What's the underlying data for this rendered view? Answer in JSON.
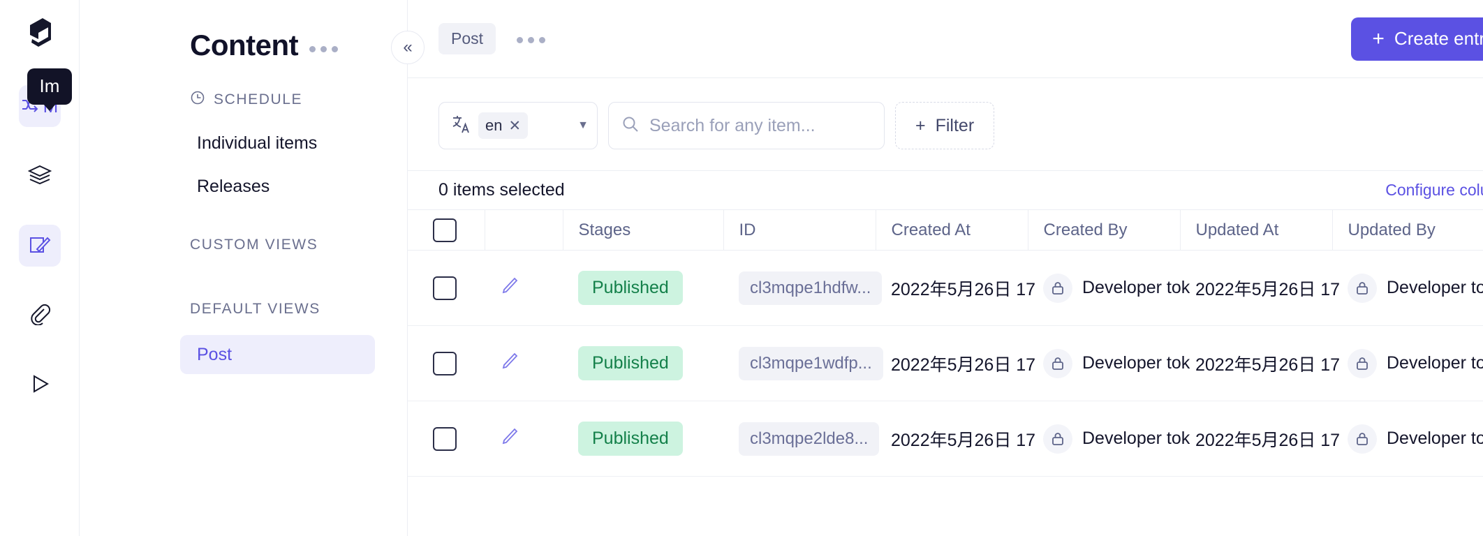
{
  "rail": {
    "logo_icon": "graphcms-logo-icon",
    "tooltip_text": "Im",
    "items": [
      {
        "icon": "schedule-shuffle-icon",
        "label": "M",
        "active": true
      },
      {
        "icon": "layers-icon",
        "label": "",
        "active": false
      },
      {
        "icon": "content-edit-icon",
        "label": "",
        "active": true
      },
      {
        "icon": "paperclip-icon",
        "label": "",
        "active": false
      },
      {
        "icon": "play-icon",
        "label": "",
        "active": false
      }
    ]
  },
  "sidebar": {
    "title": "Content",
    "more_icon": "ellipsis-icon",
    "schedule_label": "SCHEDULE",
    "schedule_icon": "clock-icon",
    "schedule_items": [
      "Individual items",
      "Releases"
    ],
    "custom_views_label": "CUSTOM VIEWS",
    "default_views_label": "DEFAULT VIEWS",
    "default_views_items": [
      {
        "label": "Post",
        "active": true
      }
    ]
  },
  "topbar": {
    "model_tag": "Post",
    "more_icon": "ellipsis-icon",
    "create_label": "Create entry",
    "create_plus": "+",
    "accent_color": "#5b51e3"
  },
  "toolbar": {
    "collapse_icon": "chevron-double-left-icon",
    "translate_icon": "translate-icon",
    "locale_value": "en",
    "locale_remove_icon": "close-icon",
    "locale_caret_icon": "chevron-down-icon",
    "search_icon": "search-icon",
    "search_value": "",
    "search_placeholder": "Search for any item...",
    "filter_plus": "+",
    "filter_label": "Filter"
  },
  "selection": {
    "count_text": "0 items selected",
    "configure_label": "Configure columns"
  },
  "table": {
    "columns": [
      "",
      "",
      "Stages",
      "ID",
      "Created At",
      "Created By",
      "Updated At",
      "Updated By"
    ],
    "header_checkbox_checked": false,
    "rows": [
      {
        "checked": false,
        "edit_icon": "pencil-icon",
        "stage": "Published",
        "id": "cl3mqpe1hdfw...",
        "created_at": "2022年5月26日 17",
        "created_by": "Developer tok",
        "created_by_icon": "lock-icon",
        "updated_at": "2022年5月26日 17",
        "updated_by": "Developer tok",
        "updated_by_icon": "lock-icon"
      },
      {
        "checked": false,
        "edit_icon": "pencil-icon",
        "stage": "Published",
        "id": "cl3mqpe1wdfp...",
        "created_at": "2022年5月26日 17",
        "created_by": "Developer tok",
        "created_by_icon": "lock-icon",
        "updated_at": "2022年5月26日 17",
        "updated_by": "Developer tok",
        "updated_by_icon": "lock-icon"
      },
      {
        "checked": false,
        "edit_icon": "pencil-icon",
        "stage": "Published",
        "id": "cl3mqpe2lde8...",
        "created_at": "2022年5月26日 17",
        "created_by": "Developer tok",
        "created_by_icon": "lock-icon",
        "updated_at": "2022年5月26日 17",
        "updated_by": "Developer tok",
        "updated_by_icon": "lock-icon"
      }
    ]
  },
  "colors": {
    "accent": "#5b51e3",
    "published_bg": "#cdf3e0",
    "published_fg": "#14804a",
    "border": "#eceef3",
    "dark": "#121327"
  }
}
